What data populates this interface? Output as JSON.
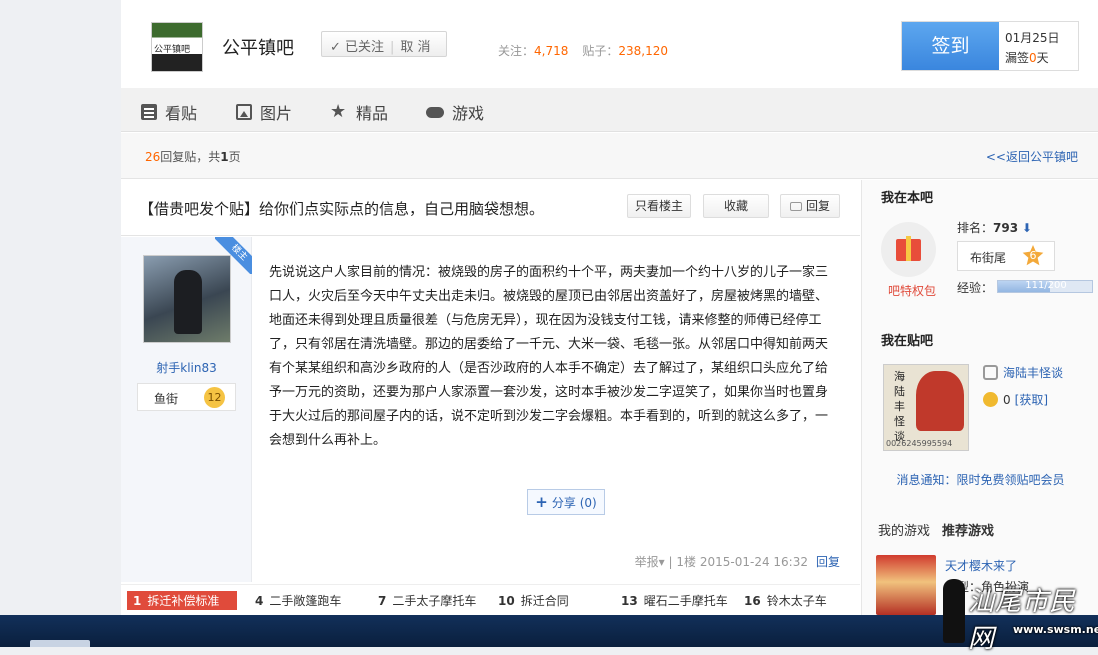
{
  "header": {
    "logo_text": "公平镇吧",
    "forum_name": "公平镇吧",
    "follow_label": "✓ 已关注",
    "unfollow_label": "取 消",
    "followers_label": "关注：",
    "followers_value": "4,718",
    "posts_label": "贴子：",
    "posts_value": "238,120",
    "sign_label": "签到",
    "sign_date": "01月25日",
    "missed_prefix": "漏签",
    "missed_value": "0",
    "missed_suffix": "天"
  },
  "nav": {
    "items": [
      {
        "label": "看贴",
        "icon": "document-icon"
      },
      {
        "label": "图片",
        "icon": "image-icon"
      },
      {
        "label": "精品",
        "icon": "star-icon"
      },
      {
        "label": "游戏",
        "icon": "gamepad-icon"
      }
    ]
  },
  "replybar": {
    "count": "26",
    "count_suffix": "回复贴，共",
    "pages": "1",
    "pages_suffix": "页",
    "back_link": "<<返回公平镇吧"
  },
  "thread": {
    "title": "【借贵吧发个贴】给你们点实际点的信息，自己用脑袋想想。",
    "only_author_label": "只看楼主",
    "favorite_label": "收藏",
    "reply_label": "回复"
  },
  "post": {
    "author_badge": "楼主",
    "username": "射手klin83",
    "level_name": "鱼街",
    "level_num": "12",
    "content": "先说说这户人家目前的情况：被烧毁的房子的面积约十个平，两夫妻加一个约十八岁的儿子一家三口人，火灾后至今天中午丈夫出走未归。被烧毁的屋顶已由邻居出资盖好了，房屋被烤黑的墙壁、地面还未得到处理且质量很差（与危房无异），现在因为没钱支付工钱，请来修整的师傅已经停工了，只有邻居在清洗墙壁。那边的居委给了一千元、大米一袋、毛毯一张。从邻居口中得知前两天有个某某组织和高沙乡政府的人（是否沙政府的人本手不确定）去了解过了，某组织口头应允了给予一万元的资助，还要为那户人家添置一套沙发，这时本手被沙发二字逗笑了，如果你当时也置身于大火过后的那间屋子内的话，说不定听到沙发二字会爆粗。本手看到的，听到的就这么多了，一会想到什么再补上。",
    "share_label": "分享 (0)",
    "report_label": "举报▾",
    "floor": "1楼",
    "datetime": "2015-01-24 16:32",
    "reply_link": "回复"
  },
  "hot": {
    "items": [
      {
        "num": "1",
        "label": "拆迁补偿标准"
      },
      {
        "num": "4",
        "label": "二手敞篷跑车"
      },
      {
        "num": "7",
        "label": "二手太子摩托车"
      },
      {
        "num": "10",
        "label": "拆迁合同"
      },
      {
        "num": "13",
        "label": "曜石二手摩托车"
      },
      {
        "num": "16",
        "label": "铃木太子车"
      }
    ]
  },
  "sidebar": {
    "my_forum_title": "我在本吧",
    "gift_label": "吧特权包",
    "rank_label": "排名：",
    "rank_value": "793",
    "rank_arrow": "⬇",
    "level_name": "布街尾",
    "level_num": "6",
    "exp_label": "经验：",
    "exp_text": "111/200",
    "exp_fraction": 0.555,
    "my_post_forum_title": "我在贴吧",
    "post_forum_image_text": "海陆丰怪谈",
    "post_forum_image_num": "0026245995594",
    "post_forum_link": "海陆丰怪谈",
    "coin_value": "0",
    "coin_link": "[获取]",
    "notice": "消息通知：限时免费领贴吧会员",
    "games_mine": "我的游戏",
    "games_recommend": "推荐游戏",
    "game_name": "天才樱木来了",
    "game_type": "类型：角色扮演"
  },
  "watermark": {
    "cn": "汕尾市民网",
    "url": "www.swsm.net"
  }
}
